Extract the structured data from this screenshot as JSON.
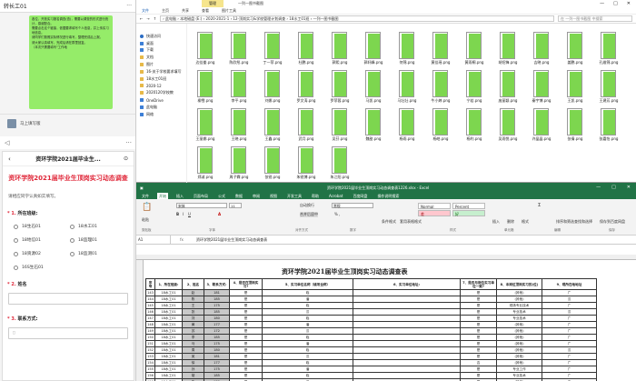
{
  "chat": {
    "header_title": "转长工01",
    "header_right": "···",
    "message_lines": [
      "各位，开放实习报名调查(查)，需要以调查的形式进行统计，感谢配合。",
      "需要点击这个链接，依据要求填写个人信息，并上传实习地信息。",
      "请同学们按照实际情况进行填写，整理完成后上报。",
      "请大家认真填写，完成后请在群里回复。",
      "（本次只需要填写\"工作地"
    ],
    "contact_name": "马上填写版",
    "bar_icons": [
      "◁",
      "···"
    ],
    "form": {
      "back": "‹",
      "header": "资环学院2021届毕业生...",
      "close": "⊙",
      "title": "资环学院2021届毕业生顶岗实习动态调查",
      "description": "请相应同学认真如实填写。",
      "q1": {
        "num": "* 1. ",
        "label": "所在班级:",
        "options": [
          "18生石01",
          "18水工01",
          "18地信01",
          "18监理01",
          "18资源02",
          "18监测01",
          "16S生石01"
        ]
      },
      "q2": {
        "num": "* 2. ",
        "label": "姓名"
      },
      "q3": {
        "num": "* 3. ",
        "label": "联系方式:"
      }
    }
  },
  "explorer": {
    "manage_tab": "管理",
    "title_path": "一列一图书截图",
    "window_controls": [
      "—",
      "□",
      "✕"
    ],
    "ribbon": [
      "文件",
      "主页",
      "共享",
      "查看",
      "图片工具"
    ],
    "address": "› 此电脑 › 本地磁盘 (E:) › 2020-2021-1 › 12-顶岗实习&学校管理计划调查 › 18水工01班 › 一列一图书截图",
    "search_placeholder": "在 一列一图书截图 中搜索",
    "nav": [
      {
        "label": "快速访问",
        "type": "star"
      },
      {
        "label": "桌面",
        "type": "b"
      },
      {
        "label": "下载",
        "type": "b"
      },
      {
        "label": "文档",
        "type": "f"
      },
      {
        "label": "图片",
        "type": "f"
      },
      {
        "label": "16-关于学校要求填写",
        "type": "f"
      },
      {
        "label": "18水工01班",
        "type": "f"
      },
      {
        "label": "2020-12",
        "type": "f"
      },
      {
        "label": "2020120学校教",
        "type": "f"
      },
      {
        "label": "OneDrive",
        "type": "b"
      },
      {
        "label": "此电脑",
        "type": "b"
      },
      {
        "label": "网络",
        "type": "b"
      }
    ],
    "files": [
      "边佳峯.png",
      "陈欣彤.png",
      "丁一菲.png",
      "杜鹏.png",
      "郭熙.png",
      "郭轩峰.png",
      "何锦.png",
      "黄佳瑶.png",
      "黄雨桐.png",
      "胡绍锋.png",
      "吉晓.png",
      "姜鹏.png",
      "孔维锦.png",
      "柳雪.png",
      "李平.png",
      "刘娜.png",
      "罗文涛.png",
      "罗菲蓉.png",
      "马凯.png",
      "马壮壮.png",
      "牛小婷.png",
      "宁若.png",
      "庞丽颖.png",
      "秦宇博.png",
      "王凯.png",
      "王建芳.png",
      "王丽娜.png",
      "王晓.png",
      "王鑫.png",
      "武月.png",
      "吴芬.png",
      "魏甜.png",
      "杨雨.png",
      "杨皓.png",
      "杨利.png",
      "吴雨悦.png",
      "许晶晶.png",
      "张倩.png",
      "张嘉怡.png",
      "郑淑.png",
      "周子霖.png",
      "张锐.png",
      "朱锐博.png",
      "朱江阳.png"
    ]
  },
  "excel": {
    "title": "资环学院2021届毕业生顶岗实习动态调查表1226.xlsx - Excel",
    "window_controls": [
      "—",
      "□",
      "✕"
    ],
    "tabs": [
      "文件",
      "开始",
      "插入",
      "页面布局",
      "公式",
      "数据",
      "审阅",
      "视图",
      "开发工具",
      "帮助",
      "Acrobat",
      "百度网盘",
      "操作说明搜索"
    ],
    "active_tab": "开始",
    "font_name": "宋体",
    "font_size": "11",
    "number_format": "常规",
    "style_normal": "Normal",
    "style_percent": "Percent",
    "style_bad": "差",
    "style_good": "好",
    "groups": [
      "剪贴板",
      "字体",
      "对齐方式",
      "数字",
      "样式",
      "单元格",
      "编辑",
      "保存"
    ],
    "buttons": {
      "paste": "粘贴",
      "wrap": "自动换行",
      "merge": "合并后居中",
      "cond": "条件格式",
      "table": "套用表格格式",
      "insert": "插入",
      "delete": "删除",
      "format": "格式",
      "sort": "排序和筛选",
      "find": "查找和选择",
      "save": "保存到百度网盘"
    },
    "name_box": "A1",
    "fx": "fx",
    "formula": "资环学院2021届毕业生顶岗实习动态调查表",
    "sheet_title": "资环学院2021届毕业生顶岗实习动态调查表",
    "headers": [
      "序号",
      "1、所在班级:",
      "2、姓名",
      "3、联系方式:",
      "4、是否在顶岗实习?",
      "5、实习单位名称（填写全称）",
      "6、实习单位地址:",
      "7、是否与岗位实习单位一致?",
      "8、本岗位顶岗实习的(位)",
      "9、现所在地地址"
    ],
    "row_numbers": [
      "3",
      "4",
      "5",
      "6",
      "7",
      "8",
      "9",
      "10",
      "11",
      "12",
      "13",
      "14",
      "15",
      "16",
      "17"
    ],
    "rows": [
      [
        "143",
        "18水工01",
        "赵",
        "181",
        "是",
        "临",
        "",
        "是",
        "(其他)",
        "广"
      ],
      [
        "144",
        "18水工01",
        "陈",
        "185",
        "是",
        "潘",
        "",
        "是",
        "(其他)",
        "汉"
      ],
      [
        "145",
        "18水工01",
        "王",
        "175",
        "是",
        "临",
        "",
        "是",
        "现场专业技术",
        "广"
      ],
      [
        "146",
        "18水工01",
        "张",
        "185",
        "是",
        "汉",
        "",
        "是",
        "专业技术",
        "汉"
      ],
      [
        "147",
        "18水工01",
        "刘",
        "180",
        "是",
        "临",
        "",
        "是",
        "专业技术",
        "广"
      ],
      [
        "148",
        "18水工01",
        "黄",
        "177",
        "是",
        "潘",
        "",
        "是",
        "(其他)",
        "广"
      ],
      [
        "149",
        "18水工01",
        "苏",
        "172",
        "是",
        "汉",
        "",
        "是",
        "(其他)",
        "广"
      ],
      [
        "150",
        "18水工01",
        "李",
        "185",
        "是",
        "临",
        "",
        "是",
        "(其他)",
        "广"
      ],
      [
        "151",
        "18水工01",
        "马",
        "175",
        "是",
        "潘",
        "",
        "是",
        "(其他)",
        "广"
      ],
      [
        "152",
        "18水工01",
        "周",
        "180",
        "是",
        "临",
        "",
        "是",
        "(其他)",
        "汉"
      ],
      [
        "153",
        "18水工01",
        "吴",
        "181",
        "是",
        "汉",
        "",
        "是",
        "(其他)",
        "广"
      ],
      [
        "154",
        "18水工01",
        "徐",
        "177",
        "是",
        "临",
        "",
        "否",
        "(其他)",
        "广"
      ],
      [
        "155",
        "18水工01",
        "孙",
        "175",
        "是",
        "潘",
        "",
        "是",
        "专业工作",
        "广"
      ],
      [
        "156",
        "18水工01",
        "胡",
        "185",
        "是",
        "临",
        "",
        "是",
        "专业技术",
        "广"
      ],
      [
        "157",
        "18水工01",
        "朱",
        "180",
        "是",
        "汉",
        "",
        "是",
        "(其他)",
        "广"
      ]
    ]
  }
}
